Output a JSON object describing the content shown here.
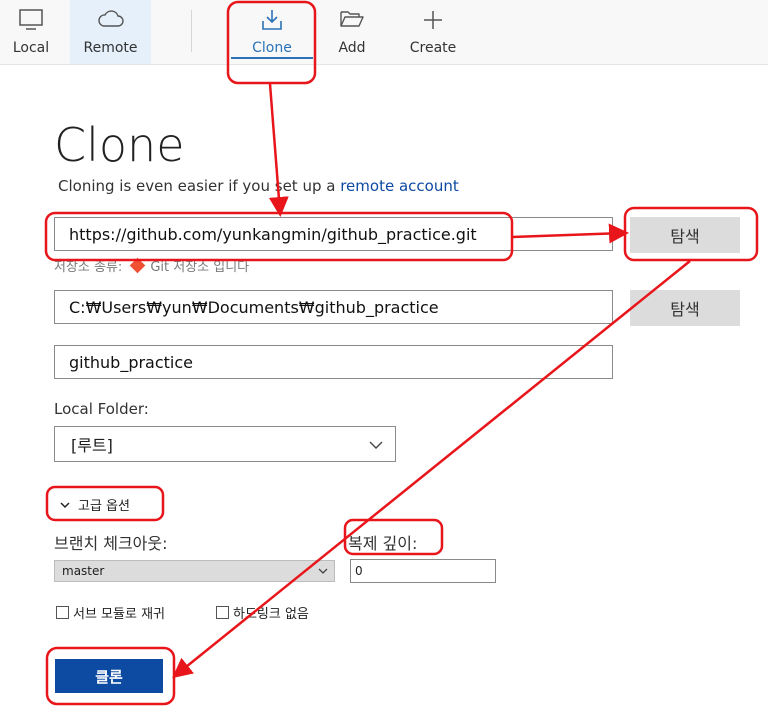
{
  "toolbar": {
    "local": "Local",
    "remote": "Remote",
    "clone": "Clone",
    "add": "Add",
    "create": "Create"
  },
  "page": {
    "title": "Clone",
    "subtitle_prefix": "Cloning is even easier if you set up a ",
    "subtitle_link": "remote account"
  },
  "form": {
    "url_value": "https://github.com/yunkangmin/github_practice.git",
    "repo_type_hint": "저장소 종류:",
    "repo_type_value": "Git 저장소 입니다",
    "browse_label": "탐색",
    "path_value": "C:₩Users₩yun₩Documents₩github_practice",
    "name_value": "github_practice",
    "local_folder_label": "Local Folder:",
    "local_folder_value": "[루트]"
  },
  "advanced": {
    "toggle_label": "고급 옵션",
    "branch_label": "브랜치 체크아웃:",
    "branch_value": "master",
    "depth_label": "복제 깊이:",
    "depth_value": "0",
    "submodules_label": "서브 모듈로 재귀",
    "no_hardlinks_label": "하드링크 없음"
  },
  "actions": {
    "clone_button": "클론"
  },
  "colors": {
    "accent": "#2b73b8",
    "primary_button": "#0d4aa2",
    "annotation": "#e8151b",
    "git_icon": "#f05033"
  }
}
